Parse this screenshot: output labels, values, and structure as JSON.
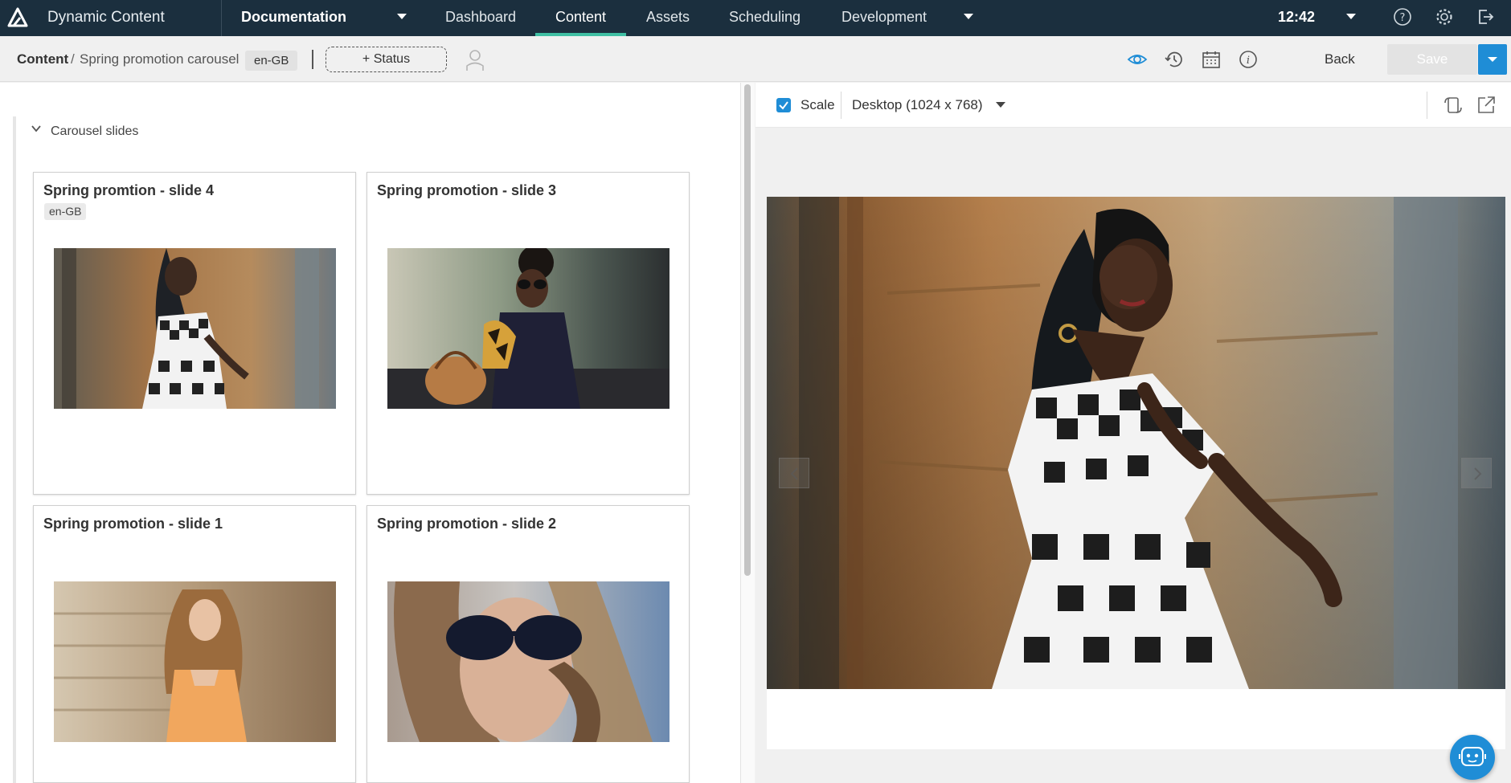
{
  "topnav": {
    "app_title": "Dynamic Content",
    "hub": "Documentation",
    "tabs": [
      "Dashboard",
      "Content",
      "Assets",
      "Scheduling",
      "Development"
    ],
    "active_tab": "Content",
    "clock": "12:42",
    "icons": [
      "help-icon",
      "settings-icon",
      "logout-icon"
    ]
  },
  "subbar": {
    "breadcrumb_root": "Content",
    "breadcrumb_sep": "/",
    "breadcrumb_item": "Spring promotion carousel",
    "locale": "en-GB",
    "status_button": "+ Status",
    "back": "Back",
    "save": "Save",
    "icons": [
      "preview-eye-icon",
      "history-icon",
      "calendar-icon",
      "info-icon"
    ]
  },
  "editor": {
    "section_title": "Carousel slides",
    "slides": [
      {
        "title": "Spring promtion - slide 4",
        "locale": "en-GB"
      },
      {
        "title": "Spring promotion - slide 3"
      },
      {
        "title": "Spring promotion - slide 1"
      },
      {
        "title": "Spring promotion - slide 2"
      }
    ]
  },
  "preview": {
    "scale_label": "Scale",
    "scale_checked": true,
    "device": "Desktop (1024 x 768)"
  },
  "colors": {
    "nav_bg": "#1b2f3e",
    "accent": "#1f8dd6",
    "active_tab_underline": "#3fbfa3"
  }
}
